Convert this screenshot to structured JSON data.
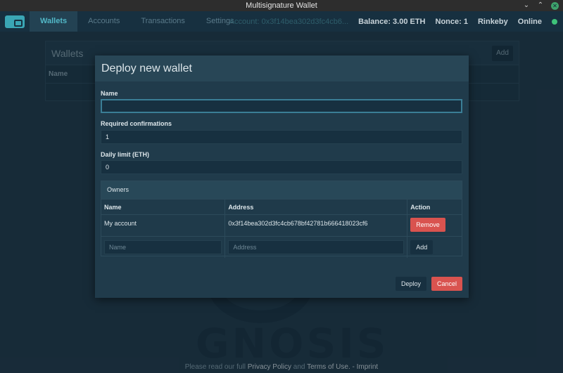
{
  "window": {
    "title": "Multisignature Wallet"
  },
  "nav": {
    "items": [
      "Wallets",
      "Accounts",
      "Transactions",
      "Settings"
    ],
    "account": "Account: 0x3f14bea302d3fc4cb6...",
    "balance": "Balance: 3.00 ETH",
    "nonce": "Nonce: 1",
    "network": "Rinkeby",
    "status": "Online"
  },
  "background": {
    "panel_title": "Wallets",
    "add_label": "Add",
    "col_name": "Name",
    "watermark": "GNOSIS"
  },
  "footer": {
    "prefix": "Please read our full",
    "privacy": "Privacy Policy",
    "and": "and",
    "terms": "Terms of Use.",
    "imprint": "- Imprint"
  },
  "modal": {
    "title": "Deploy new wallet",
    "name_label": "Name",
    "name_value": "",
    "confirmations_label": "Required confirmations",
    "confirmations_value": "1",
    "limit_label": "Daily limit (ETH)",
    "limit_value": "0",
    "owners": {
      "title": "Owners",
      "col_name": "Name",
      "col_address": "Address",
      "col_action": "Action",
      "rows": [
        {
          "name": "My account",
          "address": "0x3f14bea302d3fc4cb678bf42781b666418023cf6",
          "action": "Remove"
        }
      ],
      "new_name_placeholder": "Name",
      "new_address_placeholder": "Address",
      "add_label": "Add"
    },
    "deploy_label": "Deploy",
    "cancel_label": "Cancel"
  }
}
